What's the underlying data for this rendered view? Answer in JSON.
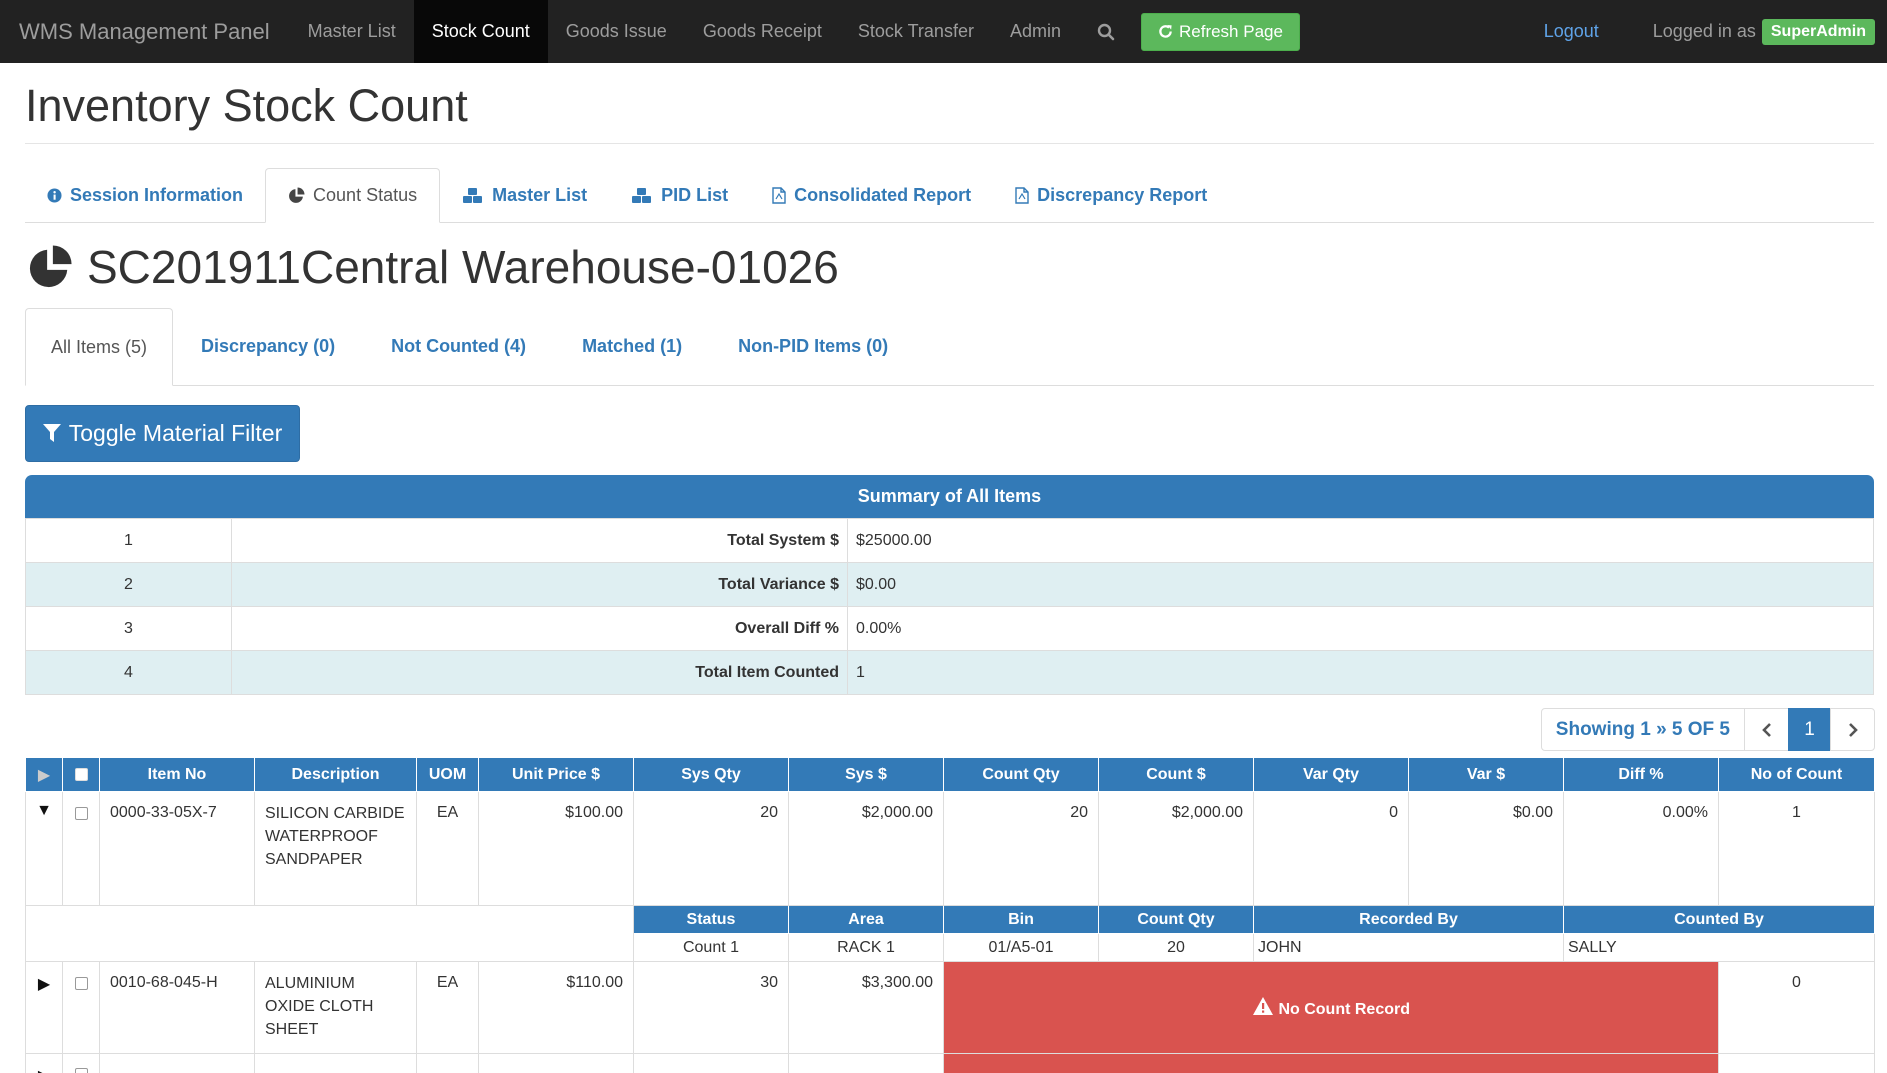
{
  "navbar": {
    "brand": "WMS Management Panel",
    "items": [
      "Master List",
      "Stock Count",
      "Goods Issue",
      "Goods Receipt",
      "Stock Transfer",
      "Admin"
    ],
    "active_index": 1,
    "refresh_label": "Refresh Page",
    "logout_label": "Logout",
    "logged_in_label": "Logged in as",
    "user": "SuperAdmin"
  },
  "page_title": "Inventory Stock Count",
  "main_tabs": [
    {
      "label": "Session Information",
      "icon": "info-circle-icon"
    },
    {
      "label": "Count Status",
      "icon": "pie-chart-icon"
    },
    {
      "label": "Master List",
      "icon": "cubes-icon"
    },
    {
      "label": "PID List",
      "icon": "cubes-icon"
    },
    {
      "label": "Consolidated Report",
      "icon": "file-pdf-icon"
    },
    {
      "label": "Discrepancy Report",
      "icon": "file-pdf-icon"
    }
  ],
  "session_title": "SC201911Central Warehouse-01026",
  "sub_tabs": [
    "All Items (5)",
    "Discrepancy (0)",
    "Not Counted (4)",
    "Matched (1)",
    "Non-PID Items (0)"
  ],
  "filter_button": "Toggle Material Filter",
  "summary": {
    "title": "Summary of All Items",
    "rows": [
      {
        "num": "1",
        "label": "Total System $",
        "value": "$25000.00"
      },
      {
        "num": "2",
        "label": "Total Variance $",
        "value": "$0.00"
      },
      {
        "num": "3",
        "label": "Overall Diff %",
        "value": "0.00%"
      },
      {
        "num": "4",
        "label": "Total Item Counted",
        "value": "1"
      }
    ]
  },
  "pagination": {
    "info": "Showing 1 » 5 OF 5",
    "page": "1"
  },
  "items_table": {
    "headers": [
      "Item No",
      "Description",
      "UOM",
      "Unit Price $",
      "Sys Qty",
      "Sys $",
      "Count Qty",
      "Count $",
      "Var Qty",
      "Var $",
      "Diff %",
      "No of Count"
    ],
    "rows": [
      {
        "item_no": "0000-33-05X-7",
        "description": "SILICON CARBIDE WATERPROOF SANDPAPER",
        "uom": "EA",
        "unit_price": "$100.00",
        "sys_qty": "20",
        "sys_amt": "$2,000.00",
        "count_qty": "20",
        "count_amt": "$2,000.00",
        "var_qty": "0",
        "var_amt": "$0.00",
        "diff": "0.00%",
        "no_of_count": "1"
      },
      {
        "item_no": "0010-68-045-H",
        "description": "ALUMINIUM OXIDE CLOTH SHEET",
        "uom": "EA",
        "unit_price": "$110.00",
        "sys_qty": "30",
        "sys_amt": "$3,300.00",
        "no_count_label": "No Count Record",
        "no_of_count": "0"
      }
    ],
    "detail": {
      "headers": [
        "Status",
        "Area",
        "Bin",
        "Count Qty",
        "Recorded By",
        "Counted By"
      ],
      "row": {
        "status": "Count 1",
        "area": "RACK 1",
        "bin": "01/A5-01",
        "count_qty": "20",
        "recorded_by": "JOHN",
        "counted_by": "SALLY"
      }
    }
  },
  "colors": {
    "navbar": "#222222",
    "primary": "#337ab7",
    "success": "#5cb85c",
    "danger": "#d9534f",
    "stripe": "#dfeff2"
  }
}
